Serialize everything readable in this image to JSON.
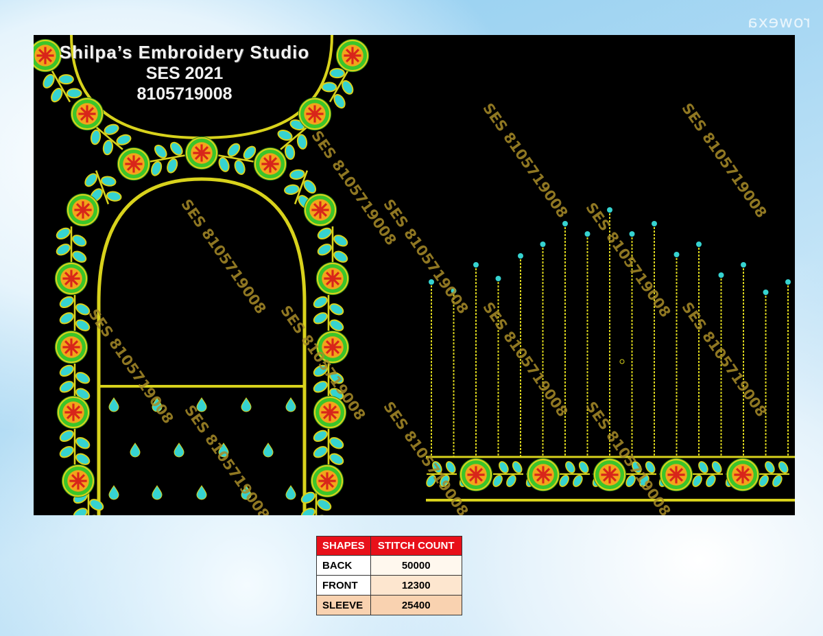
{
  "watermark_corner": "rowexa",
  "studio": {
    "name": "Shilpa’s Embroidery Studio",
    "code": "SES 2021",
    "phone": "8105719008"
  },
  "design_watermark": "SES 8105719008",
  "stitch_table": {
    "headers": [
      "SHAPES",
      "STITCH COUNT"
    ],
    "rows": [
      {
        "shape": "BACK",
        "count": "50000"
      },
      {
        "shape": "FRONT",
        "count": "12300"
      },
      {
        "shape": "SLEEVE",
        "count": "25400"
      }
    ]
  },
  "colors": {
    "background": "#000000",
    "gold": "#d8d21c",
    "flower_green": "#3bc52a",
    "flower_orange": "#f2a51a",
    "flower_red": "#d8251a",
    "leaf_cyan": "#36d3d0"
  }
}
